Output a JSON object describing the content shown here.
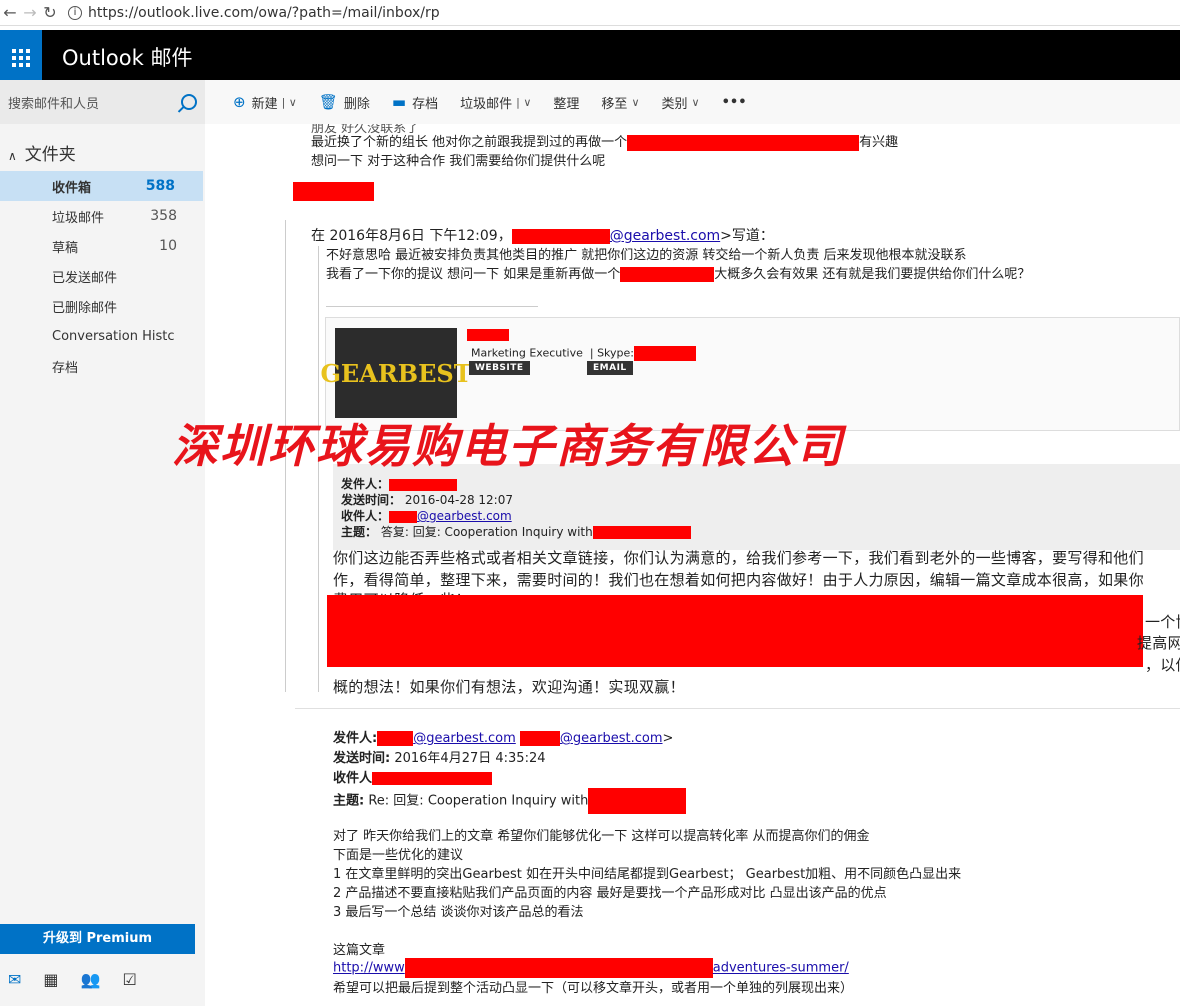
{
  "browser": {
    "url": "https://outlook.live.com/owa/?path=/mail/inbox/rp"
  },
  "header": {
    "brand": "Outlook 邮件"
  },
  "sidebar": {
    "search_placeholder": "搜索邮件和人员",
    "folders_title": "文件夹",
    "items": [
      {
        "label": "收件箱",
        "count": "588"
      },
      {
        "label": "垃圾邮件",
        "count": "358"
      },
      {
        "label": "草稿",
        "count": "10"
      },
      {
        "label": "已发送邮件",
        "count": ""
      },
      {
        "label": "已删除邮件",
        "count": ""
      },
      {
        "label": "Conversation Histc",
        "count": ""
      },
      {
        "label": "存档",
        "count": ""
      }
    ],
    "premium_label": "升级到 Premium"
  },
  "toolbar": {
    "new": "新建",
    "delete": "删除",
    "archive": "存档",
    "junk": "垃圾邮件",
    "sweep": "整理",
    "move": "移至",
    "category": "类别",
    "more": "•••"
  },
  "email": {
    "l1": "朋友 好久没联系了",
    "l2a": "最近换了个新的组长 他对你之前跟我提到过的再做一个",
    "l2b": "有兴趣",
    "l3": "想问一下 对于这种合作 我们需要给你们提供什么呢",
    "quote_hdr_a": "在 2016年8月6日 下午12:09，",
    "quote_hdr_link": "@gearbest.com",
    "quote_hdr_b": ">写道：",
    "q1": "不好意思哈 最近被安排负责其他类目的推广 就把你们这边的资源 转交给一个新人负责 后来发现他根本就没联系",
    "q2a": "我看了一下你的提议 想问一下 如果是重新再做一个",
    "q2b": "大概多久会有效果 还有就是我们要提供给你们什么呢？",
    "sig_title": "Marketing Executive",
    "sig_skype": "| Skype:",
    "sig_logo": "GEARBEST",
    "sig_website": "WEBSITE",
    "sig_email": "EMAIL",
    "h_from": "发件人：",
    "h_sent": "发送时间：",
    "h_sent_val": "2016-04-28 12:07",
    "h_to": "收件人：",
    "h_to_link": "@gearbest.com",
    "h_subj": "主题：",
    "h_subj_val": "答复: 回复: Cooperation Inquiry with",
    "b1": "你们这边能否弄些格式或者相关文章链接，你们认为满意的，给我们参考一下，我们看到老外的一些博客，要写得和他们",
    "b2": "作，看得简单，整理下来，需要时间的！我们也在想着如何把内容做好！由于人力原因，编辑一篇文章成本很高，如果你",
    "b3": "费用可以降低一些！",
    "b4r": "一个博",
    "b5r": "提高网",
    "b6r": "，以你",
    "b7": "概的想法！如果你们有想法，欢迎沟通！实现双赢！",
    "f_from": "发件人:",
    "f_from_l1": "@gearbest.com",
    "f_from_l2": "@gearbest.com",
    "f_from_end": ">",
    "f_sent": "发送时间:",
    "f_sent_val": "2016年4月27日 4:35:24",
    "f_to": "收件人",
    "f_subj": "主题:",
    "f_subj_val": "Re: 回复: Cooperation Inquiry with",
    "m1": "对了 昨天你给我们上的文章 希望你们能够优化一下 这样可以提高转化率 从而提高你们的佣金",
    "m2": "下面是一些优化的建议",
    "m3": "1 在文章里鲜明的突出Gearbest 如在开头中间结尾都提到Gearbest；  Gearbest加粗、用不同颜色凸显出来",
    "m4": "2 产品描述不要直接粘贴我们产品页面的内容 最好是要找一个产品形成对比 凸显出该产品的优点",
    "m5": "3 最后写一个总结 谈谈你对该产品总的看法",
    "m6": "这篇文章",
    "link_a": "http://www",
    "link_b": "adventures-summer/",
    "m7": "希望可以把最后提到整个活动凸显一下（可以移文章开头，或者用一个单独的列展现出来）"
  },
  "watermark": "深圳环球易购电子商务有限公司",
  "colors": {
    "accent": "#0072c6",
    "redaction": "#ff0000",
    "watermark": "#e8141b"
  }
}
